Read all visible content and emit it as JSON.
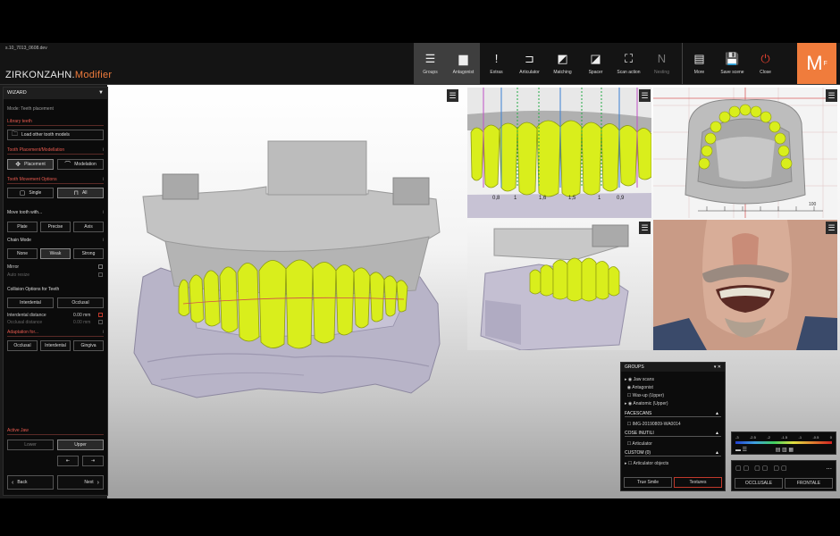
{
  "app": {
    "filename": "s.10_7013_0608.dev",
    "brand_main": "ZIRKONZAHN.",
    "brand_sub": "Modifier",
    "logo_main": "M",
    "logo_sub": "F"
  },
  "toolbar": {
    "tools": [
      {
        "label": "Groups",
        "icon": "☰",
        "active": true
      },
      {
        "label": "Antagonist",
        "icon": "▆",
        "active": true
      },
      {
        "label": "Extras",
        "icon": "!"
      },
      {
        "label": "Articulator",
        "icon": "⊐"
      },
      {
        "label": "Matching",
        "icon": "◩"
      },
      {
        "label": "Spacer",
        "icon": "◪"
      },
      {
        "label": "Scan action",
        "icon": "⛶"
      },
      {
        "label": "Nesting",
        "icon": "N",
        "dim": true
      }
    ],
    "more": {
      "label": "More",
      "icon": "▤"
    },
    "save_scene": {
      "label": "Save scene",
      "icon": "💾"
    },
    "close": {
      "label": "Close",
      "icon": "⏻"
    }
  },
  "sidebar": {
    "header": "WIZARD",
    "mode": "Mode: Teeth placement",
    "library_title": "Library teeth",
    "load_models": "Load other tooth models",
    "placement_title": "Tooth Placement/Modellation",
    "placement": "Placement",
    "modelation": "Modelation",
    "movement_title": "Tooth Movement Options",
    "single": "Single",
    "all": "All",
    "move_with": "Move tooth with...",
    "plate": "Plate",
    "precise": "Precise",
    "axis": "Axis",
    "chain_mode": "Chain Mode",
    "none": "None",
    "weak": "Weak",
    "strong": "Strong",
    "mirror": "Mirror",
    "auto_resize": "Auto resize",
    "collision_title": "Collision Options for Teeth",
    "interdental": "Interdental",
    "occlusal": "Occlusal",
    "interdental_distance": "Interdental distance",
    "interdental_value": "0.00",
    "occlusal_distance": "Occlusal distance",
    "occlusal_value": "0.00",
    "unit": "mm",
    "adaptation_title": "Adaptation for...",
    "occlusal2": "Occlusal",
    "interdental2": "Interdental",
    "gingiva": "Gingiva",
    "active_jaw": "Active Jaw",
    "lower": "Lower",
    "upper": "Upper",
    "back": "Back",
    "next": "Next"
  },
  "labels": {
    "measure": [
      "0,8",
      "1",
      "1,6",
      "1,5",
      "1",
      "0,9"
    ],
    "ruler": "100"
  },
  "groups_panel": {
    "title": "GROUPS",
    "items": [
      "Jaw scans",
      "Antagonist",
      "Wax-up (Upper)",
      "Anatomic (Upper)"
    ],
    "facescans_title": "FACESCANS",
    "facescan_item": "IMG-20190809-WA0014",
    "cose_title": "COSE INUTILI",
    "cose_item": "Articulator",
    "custom_title": "CUSTOM (0)",
    "custom_item": "Articulator objects",
    "true_smile": "True Smile",
    "textures": "Textures"
  },
  "scale_panel": {
    "values": [
      "-3",
      "-2.5",
      "-2",
      "-1.5",
      "-1",
      "-0.5",
      "0"
    ]
  },
  "view_panel": {
    "occlusale": "OCCLUSALE",
    "frontale": "FRONTALE",
    "more": "..."
  },
  "colors": {
    "accent": "#f07c3c",
    "section_red": "#e85a4f",
    "tooth_yellow": "#d9ee1c"
  }
}
